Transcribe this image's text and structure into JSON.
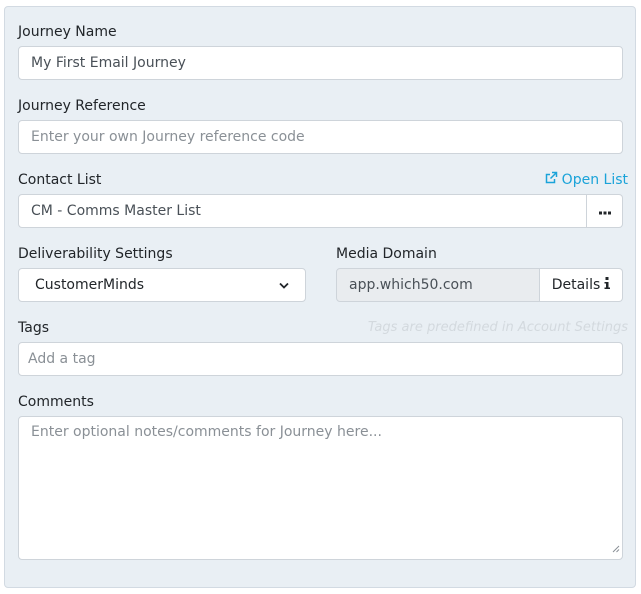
{
  "journey_name": {
    "label": "Journey Name",
    "value": "My First Email Journey"
  },
  "journey_reference": {
    "label": "Journey Reference",
    "placeholder": "Enter your own Journey reference code"
  },
  "contact_list": {
    "label": "Contact List",
    "open_link": "Open List",
    "value": "CM - Comms Master List",
    "menu_icon": "ellipsis-icon"
  },
  "deliverability": {
    "label": "Deliverability Settings",
    "selected": "CustomerMinds"
  },
  "media_domain": {
    "label": "Media Domain",
    "value": "app.which50.com",
    "details_label": "Details"
  },
  "tags": {
    "label": "Tags",
    "hint": "Tags are predefined in Account Settings",
    "placeholder": "Add a tag"
  },
  "comments": {
    "label": "Comments",
    "placeholder": "Enter optional notes/comments for Journey here..."
  },
  "colors": {
    "panel_bg": "#e9eff4",
    "link": "#1aa3d9",
    "border": "#ced4da",
    "readonly_bg": "#e9ecef"
  }
}
